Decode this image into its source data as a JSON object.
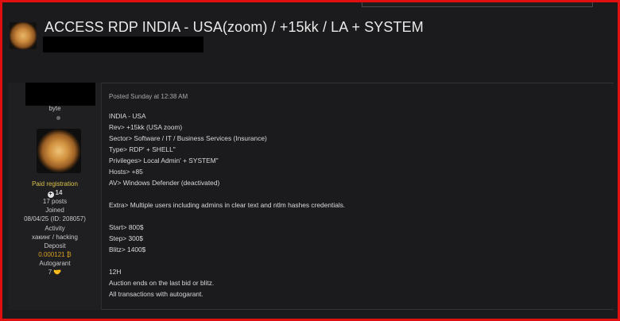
{
  "thread": {
    "title": "ACCESS RDP INDIA - USA(zoom) / +15kk / LA + SYSTEM"
  },
  "user": {
    "rank": "byte",
    "group": "Paid registration",
    "reputation": "14",
    "posts": "17 posts",
    "joined_label": "Joined",
    "joined_value": "08/04/25 (ID: 208057)",
    "activity_label": "Activity",
    "activity_value": "хакинг / hacking",
    "deposit_label": "Deposit",
    "deposit_value": "0.000121 ₿",
    "autogarant_label": "Autogarant",
    "autogarant_value": "7"
  },
  "post": {
    "meta": "Posted Sunday at 12:38 AM",
    "lines": [
      "INDIA - USA",
      "Rev> +15kk (USA zoom)",
      "Sector> Software / IT / Business Services (Insurance)",
      "Type> RDP' + SHELL\"",
      "Privileges> Local Admin' + SYSTEM\"",
      "Hosts> +85",
      "AV> Windows Defender (deactivated)",
      "Extra> Multiple users including admins in clear text and ntlm hashes credentials.",
      "Start>  800$",
      "Step>  300$",
      "Blitz> 1400$",
      "12H",
      "Auction ends on the last bid or blitz.",
      "All transactions with autogarant."
    ]
  },
  "colors": {
    "frame": "#e01010",
    "paid": "#d8c24a",
    "deposit": "#d8a020"
  }
}
